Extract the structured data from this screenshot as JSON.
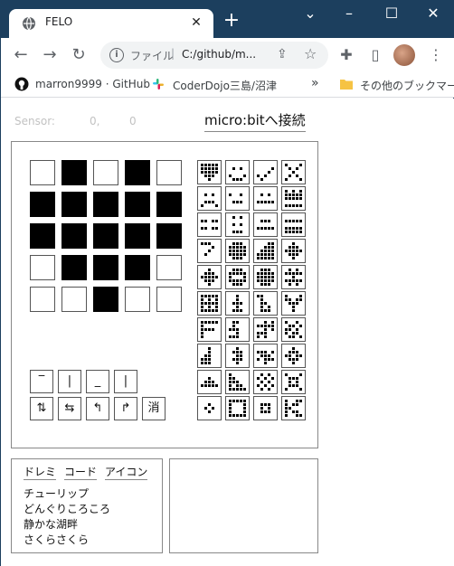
{
  "browser": {
    "tab_title": "FELO",
    "new_tab": "+",
    "url_scheme": "ファイル",
    "url_sep": "|",
    "url": "C:/github/m...",
    "bookmarks": [
      "marron9999 · GitHub",
      "CoderDojo三島/沼津"
    ],
    "bookmarks_more": "»",
    "bookmarks_other": "その他のブックマーク"
  },
  "sensor": {
    "label": "Sensor:",
    "x": "0,",
    "y": "0"
  },
  "connect_label": "micro:bitへ接続",
  "led_matrix": [
    [
      0,
      1,
      0,
      1,
      0
    ],
    [
      1,
      1,
      1,
      1,
      1
    ],
    [
      1,
      1,
      1,
      1,
      1
    ],
    [
      0,
      1,
      1,
      1,
      0
    ],
    [
      0,
      0,
      1,
      0,
      0
    ]
  ],
  "tools_row1": [
    "‾",
    "|",
    "_",
    "|"
  ],
  "tools_row2": [
    "⇅",
    "⇆",
    "↰",
    "↱",
    "消"
  ],
  "tabs": [
    "ドレミ",
    "コード",
    "アイコン"
  ],
  "songs": [
    "チューリップ",
    "どんぐりころころ",
    "静かな湖畔",
    "さくらさくら"
  ],
  "thumbnails": [
    [
      [
        1,
        1,
        1,
        1,
        1
      ],
      [
        1,
        1,
        1,
        1,
        1
      ],
      [
        1,
        1,
        1,
        1,
        1
      ],
      [
        0,
        1,
        1,
        1,
        0
      ],
      [
        0,
        0,
        1,
        0,
        0
      ]
    ],
    [
      [
        0,
        0,
        0,
        0,
        0
      ],
      [
        0,
        1,
        0,
        1,
        0
      ],
      [
        0,
        0,
        0,
        0,
        0
      ],
      [
        1,
        0,
        0,
        0,
        1
      ],
      [
        0,
        1,
        1,
        1,
        0
      ]
    ],
    [
      [
        0,
        0,
        0,
        0,
        0
      ],
      [
        0,
        0,
        0,
        0,
        1
      ],
      [
        0,
        0,
        0,
        1,
        0
      ],
      [
        1,
        0,
        1,
        0,
        0
      ],
      [
        0,
        1,
        0,
        0,
        0
      ]
    ],
    [
      [
        1,
        0,
        0,
        0,
        1
      ],
      [
        0,
        1,
        0,
        1,
        0
      ],
      [
        0,
        0,
        1,
        0,
        0
      ],
      [
        0,
        1,
        0,
        1,
        0
      ],
      [
        1,
        0,
        0,
        0,
        1
      ]
    ],
    [
      [
        0,
        0,
        0,
        0,
        0
      ],
      [
        0,
        1,
        0,
        1,
        0
      ],
      [
        0,
        0,
        0,
        0,
        0
      ],
      [
        0,
        1,
        1,
        1,
        0
      ],
      [
        1,
        0,
        0,
        0,
        1
      ]
    ],
    [
      [
        0,
        0,
        0,
        0,
        0
      ],
      [
        1,
        0,
        0,
        1,
        0
      ],
      [
        0,
        0,
        0,
        0,
        0
      ],
      [
        0,
        1,
        1,
        1,
        0
      ],
      [
        0,
        0,
        0,
        0,
        0
      ]
    ],
    [
      [
        0,
        0,
        0,
        0,
        0
      ],
      [
        0,
        1,
        0,
        1,
        0
      ],
      [
        0,
        0,
        0,
        0,
        0
      ],
      [
        1,
        1,
        1,
        1,
        1
      ],
      [
        0,
        0,
        0,
        0,
        0
      ]
    ],
    [
      [
        1,
        0,
        1,
        0,
        1
      ],
      [
        1,
        1,
        1,
        1,
        1
      ],
      [
        1,
        1,
        1,
        1,
        1
      ],
      [
        0,
        0,
        0,
        0,
        0
      ],
      [
        1,
        1,
        1,
        1,
        1
      ]
    ],
    [
      [
        0,
        0,
        0,
        0,
        0
      ],
      [
        1,
        1,
        0,
        1,
        1
      ],
      [
        0,
        0,
        0,
        0,
        0
      ],
      [
        1,
        1,
        0,
        1,
        1
      ],
      [
        0,
        0,
        0,
        0,
        0
      ]
    ],
    [
      [
        0,
        1,
        0,
        1,
        0
      ],
      [
        0,
        0,
        0,
        0,
        0
      ],
      [
        0,
        1,
        0,
        1,
        0
      ],
      [
        0,
        0,
        0,
        0,
        0
      ],
      [
        0,
        1,
        1,
        1,
        0
      ]
    ],
    [
      [
        0,
        0,
        0,
        0,
        0
      ],
      [
        0,
        1,
        1,
        1,
        0
      ],
      [
        0,
        0,
        0,
        0,
        0
      ],
      [
        1,
        1,
        1,
        1,
        1
      ],
      [
        0,
        0,
        0,
        0,
        0
      ]
    ],
    [
      [
        0,
        0,
        0,
        0,
        0
      ],
      [
        1,
        1,
        1,
        1,
        1
      ],
      [
        0,
        0,
        0,
        0,
        0
      ],
      [
        1,
        1,
        1,
        1,
        1
      ],
      [
        1,
        1,
        1,
        1,
        1
      ]
    ],
    [
      [
        1,
        1,
        1,
        0,
        0
      ],
      [
        0,
        0,
        0,
        1,
        0
      ],
      [
        0,
        0,
        1,
        0,
        0
      ],
      [
        0,
        1,
        0,
        0,
        0
      ],
      [
        0,
        0,
        0,
        0,
        0
      ]
    ],
    [
      [
        0,
        1,
        1,
        1,
        0
      ],
      [
        1,
        1,
        1,
        1,
        1
      ],
      [
        1,
        1,
        1,
        1,
        1
      ],
      [
        1,
        1,
        1,
        1,
        1
      ],
      [
        0,
        1,
        1,
        1,
        0
      ]
    ],
    [
      [
        0,
        0,
        0,
        1,
        1
      ],
      [
        0,
        0,
        1,
        1,
        1
      ],
      [
        0,
        1,
        1,
        1,
        1
      ],
      [
        1,
        1,
        1,
        1,
        1
      ],
      [
        1,
        1,
        1,
        1,
        1
      ]
    ],
    [
      [
        0,
        0,
        1,
        0,
        0
      ],
      [
        0,
        1,
        1,
        1,
        0
      ],
      [
        1,
        1,
        1,
        1,
        1
      ],
      [
        0,
        1,
        1,
        1,
        0
      ],
      [
        0,
        0,
        1,
        0,
        0
      ]
    ],
    [
      [
        0,
        0,
        1,
        0,
        0
      ],
      [
        0,
        1,
        1,
        1,
        0
      ],
      [
        1,
        1,
        1,
        1,
        1
      ],
      [
        0,
        1,
        1,
        1,
        0
      ],
      [
        0,
        0,
        1,
        0,
        0
      ]
    ],
    [
      [
        0,
        1,
        1,
        1,
        0
      ],
      [
        1,
        1,
        1,
        1,
        1
      ],
      [
        1,
        0,
        0,
        0,
        1
      ],
      [
        1,
        1,
        1,
        1,
        1
      ],
      [
        0,
        1,
        1,
        1,
        0
      ]
    ],
    [
      [
        0,
        1,
        1,
        1,
        0
      ],
      [
        1,
        1,
        1,
        1,
        1
      ],
      [
        1,
        1,
        1,
        1,
        1
      ],
      [
        1,
        1,
        1,
        1,
        1
      ],
      [
        0,
        1,
        1,
        1,
        0
      ]
    ],
    [
      [
        0,
        1,
        0,
        1,
        0
      ],
      [
        1,
        1,
        1,
        1,
        1
      ],
      [
        0,
        0,
        1,
        0,
        0
      ],
      [
        1,
        1,
        1,
        1,
        1
      ],
      [
        0,
        1,
        0,
        1,
        0
      ]
    ],
    [
      [
        1,
        1,
        1,
        1,
        1
      ],
      [
        1,
        0,
        1,
        0,
        1
      ],
      [
        1,
        1,
        1,
        1,
        1
      ],
      [
        1,
        0,
        1,
        0,
        1
      ],
      [
        1,
        1,
        1,
        1,
        1
      ]
    ],
    [
      [
        0,
        0,
        1,
        0,
        0
      ],
      [
        0,
        0,
        1,
        0,
        0
      ],
      [
        0,
        1,
        1,
        1,
        0
      ],
      [
        0,
        0,
        1,
        0,
        0
      ],
      [
        0,
        1,
        1,
        1,
        0
      ]
    ],
    [
      [
        1,
        1,
        0,
        0,
        0
      ],
      [
        0,
        1,
        0,
        0,
        0
      ],
      [
        0,
        1,
        1,
        0,
        0
      ],
      [
        0,
        1,
        0,
        1,
        0
      ],
      [
        0,
        1,
        1,
        1,
        0
      ]
    ],
    [
      [
        1,
        0,
        0,
        0,
        1
      ],
      [
        1,
        1,
        0,
        1,
        1
      ],
      [
        0,
        1,
        1,
        1,
        0
      ],
      [
        0,
        0,
        1,
        0,
        0
      ],
      [
        0,
        0,
        1,
        0,
        0
      ]
    ],
    [
      [
        1,
        1,
        1,
        1,
        1
      ],
      [
        1,
        0,
        0,
        0,
        0
      ],
      [
        1,
        1,
        1,
        1,
        0
      ],
      [
        1,
        0,
        0,
        0,
        0
      ],
      [
        1,
        0,
        0,
        0,
        0
      ]
    ],
    [
      [
        0,
        1,
        1,
        0,
        0
      ],
      [
        0,
        1,
        0,
        0,
        0
      ],
      [
        1,
        1,
        1,
        0,
        0
      ],
      [
        0,
        0,
        1,
        0,
        0
      ],
      [
        1,
        1,
        1,
        0,
        0
      ]
    ],
    [
      [
        0,
        0,
        1,
        0,
        1
      ],
      [
        1,
        1,
        1,
        1,
        1
      ],
      [
        0,
        0,
        1,
        0,
        1
      ],
      [
        1,
        1,
        1,
        0,
        0
      ],
      [
        1,
        0,
        1,
        0,
        0
      ]
    ],
    [
      [
        1,
        0,
        0,
        1,
        0
      ],
      [
        0,
        1,
        1,
        0,
        1
      ],
      [
        1,
        1,
        0,
        1,
        0
      ],
      [
        1,
        0,
        1,
        1,
        0
      ],
      [
        0,
        1,
        1,
        0,
        1
      ]
    ],
    [
      [
        0,
        0,
        1,
        0,
        0
      ],
      [
        0,
        0,
        1,
        0,
        0
      ],
      [
        0,
        1,
        1,
        0,
        0
      ],
      [
        1,
        1,
        1,
        0,
        0
      ],
      [
        1,
        1,
        1,
        0,
        0
      ]
    ],
    [
      [
        0,
        0,
        1,
        0,
        0
      ],
      [
        0,
        1,
        1,
        1,
        0
      ],
      [
        0,
        0,
        1,
        1,
        0
      ],
      [
        0,
        1,
        1,
        1,
        0
      ],
      [
        0,
        0,
        1,
        0,
        0
      ]
    ],
    [
      [
        0,
        0,
        0,
        0,
        0
      ],
      [
        1,
        1,
        1,
        0,
        1
      ],
      [
        0,
        1,
        1,
        1,
        0
      ],
      [
        1,
        0,
        1,
        1,
        1
      ],
      [
        0,
        0,
        1,
        0,
        0
      ]
    ],
    [
      [
        0,
        0,
        1,
        0,
        0
      ],
      [
        0,
        1,
        1,
        1,
        0
      ],
      [
        1,
        1,
        0,
        1,
        1
      ],
      [
        0,
        1,
        1,
        1,
        0
      ],
      [
        0,
        0,
        1,
        0,
        0
      ]
    ],
    [
      [
        0,
        0,
        0,
        0,
        0
      ],
      [
        0,
        0,
        1,
        0,
        0
      ],
      [
        0,
        1,
        1,
        1,
        0
      ],
      [
        1,
        1,
        1,
        1,
        1
      ],
      [
        0,
        0,
        0,
        0,
        0
      ]
    ],
    [
      [
        1,
        0,
        0,
        0,
        0
      ],
      [
        1,
        1,
        0,
        0,
        0
      ],
      [
        1,
        1,
        1,
        0,
        0
      ],
      [
        1,
        0,
        1,
        1,
        0
      ],
      [
        1,
        1,
        1,
        1,
        1
      ]
    ],
    [
      [
        0,
        1,
        0,
        1,
        0
      ],
      [
        1,
        0,
        1,
        0,
        1
      ],
      [
        0,
        1,
        0,
        1,
        0
      ],
      [
        1,
        0,
        1,
        0,
        1
      ],
      [
        0,
        1,
        0,
        1,
        0
      ]
    ],
    [
      [
        1,
        0,
        0,
        0,
        1
      ],
      [
        0,
        1,
        1,
        1,
        0
      ],
      [
        0,
        1,
        0,
        1,
        0
      ],
      [
        0,
        1,
        1,
        1,
        0
      ],
      [
        1,
        0,
        0,
        0,
        1
      ]
    ],
    [
      [
        0,
        0,
        0,
        0,
        0
      ],
      [
        0,
        0,
        1,
        0,
        0
      ],
      [
        0,
        1,
        0,
        1,
        0
      ],
      [
        0,
        0,
        1,
        0,
        0
      ],
      [
        0,
        0,
        0,
        0,
        0
      ]
    ],
    [
      [
        1,
        1,
        1,
        1,
        1
      ],
      [
        1,
        0,
        0,
        0,
        1
      ],
      [
        1,
        0,
        0,
        0,
        1
      ],
      [
        1,
        0,
        0,
        0,
        1
      ],
      [
        1,
        1,
        1,
        1,
        1
      ]
    ],
    [
      [
        0,
        0,
        0,
        0,
        0
      ],
      [
        0,
        1,
        1,
        1,
        0
      ],
      [
        0,
        1,
        0,
        1,
        0
      ],
      [
        0,
        1,
        1,
        1,
        0
      ],
      [
        0,
        0,
        0,
        0,
        0
      ]
    ],
    [
      [
        1,
        0,
        0,
        1,
        1
      ],
      [
        1,
        0,
        1,
        1,
        0
      ],
      [
        1,
        1,
        0,
        0,
        0
      ],
      [
        1,
        0,
        1,
        1,
        0
      ],
      [
        1,
        0,
        0,
        1,
        1
      ]
    ]
  ]
}
